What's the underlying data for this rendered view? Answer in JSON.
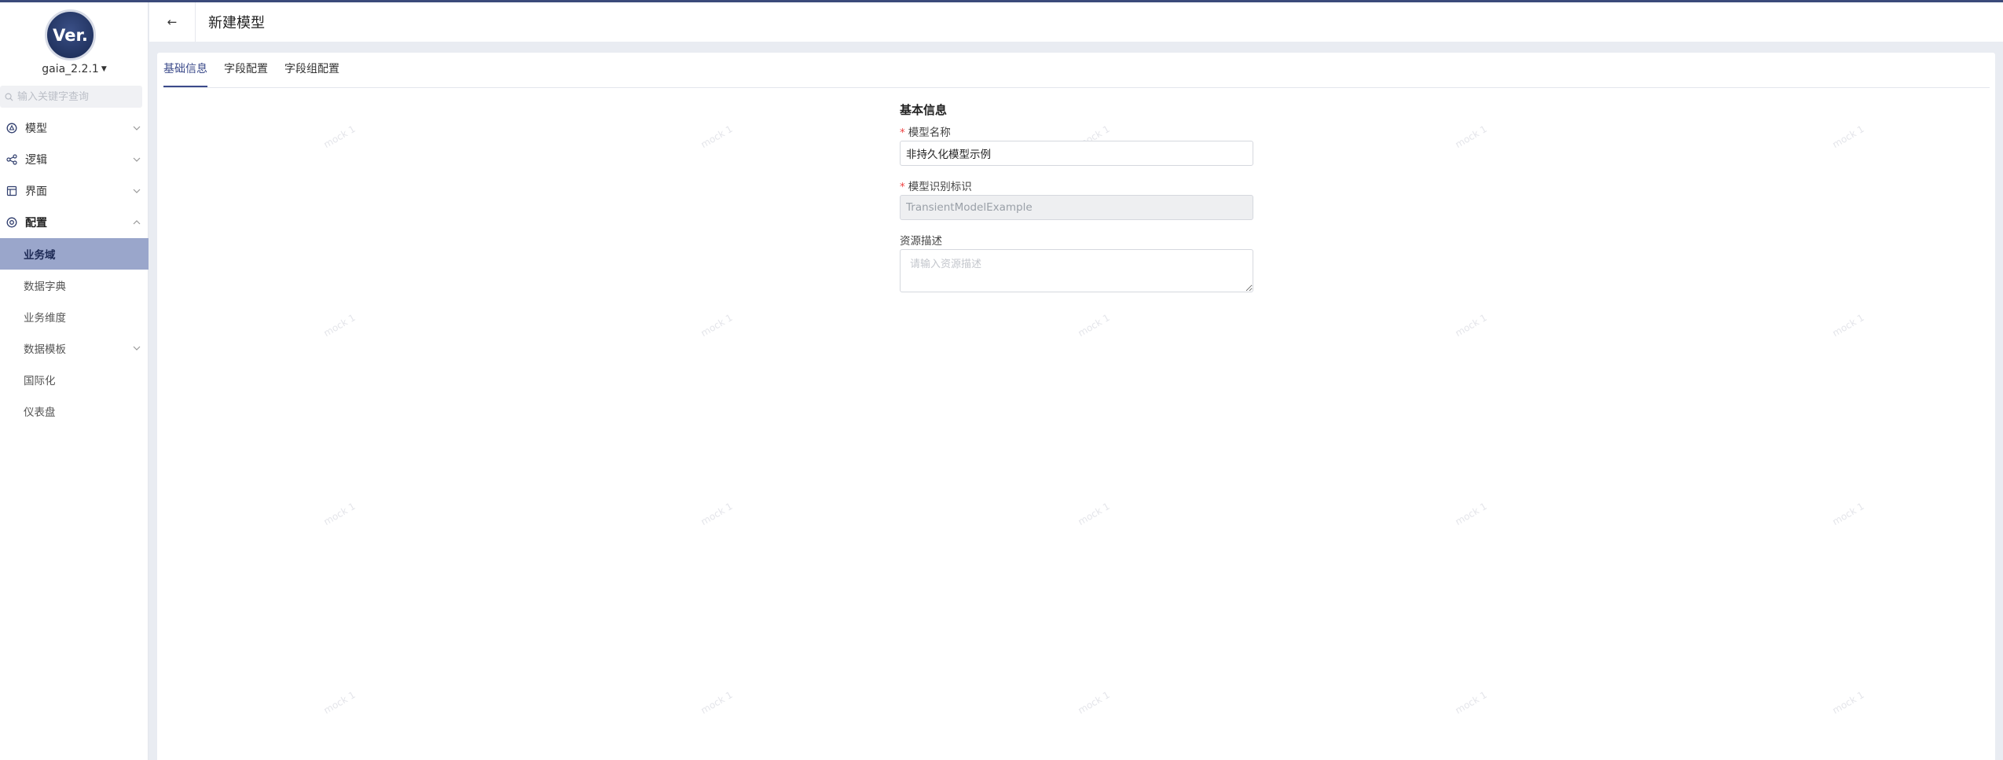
{
  "app": {
    "logo_text": "Ver.",
    "version": "gaia_2.2.1"
  },
  "sidebar": {
    "search_placeholder": "输入关键字查询",
    "items": [
      {
        "label": "模型",
        "icon": "model-icon",
        "expanded": false
      },
      {
        "label": "逻辑",
        "icon": "logic-share-icon",
        "expanded": false
      },
      {
        "label": "界面",
        "icon": "layout-icon",
        "expanded": false
      },
      {
        "label": "配置",
        "icon": "settings-icon",
        "expanded": true
      }
    ],
    "sub_items": [
      {
        "label": "业务域",
        "active": true
      },
      {
        "label": "数据字典"
      },
      {
        "label": "业务维度"
      },
      {
        "label": "数据模板",
        "has_children": true
      },
      {
        "label": "国际化"
      },
      {
        "label": "仪表盘"
      }
    ]
  },
  "header": {
    "back_label": "←",
    "title": "新建模型"
  },
  "tabs": [
    {
      "label": "基础信息",
      "active": true
    },
    {
      "label": "字段配置"
    },
    {
      "label": "字段组配置"
    }
  ],
  "form": {
    "section_title": "基本信息",
    "name_label": "模型名称",
    "name_value": "非持久化模型示例",
    "id_label": "模型识别标识",
    "id_value": "TransientModelExample",
    "desc_label": "资源描述",
    "desc_placeholder": "请输入资源描述"
  },
  "watermark": "mock 1",
  "colors": {
    "accent": "#3b4a8a",
    "active_bg": "#9aa6cb",
    "required": "#e44444"
  }
}
